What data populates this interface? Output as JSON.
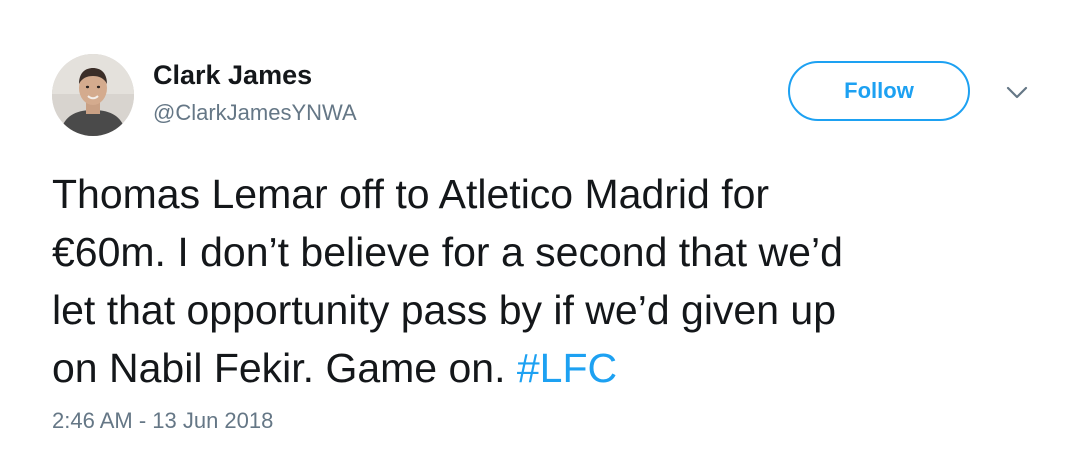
{
  "author": {
    "name": "Clark James",
    "handle": "@ClarkJamesYNWA"
  },
  "follow_button": {
    "label": "Follow"
  },
  "menu": {
    "icon": "chevron-down-icon"
  },
  "tweet": {
    "lines": [
      "Thomas Lemar off to Atletico Madrid for",
      "€60m. I don’t believe for a second that we’d",
      "let that opportunity pass by if we’d given up",
      "on Nabil Fekir. Game on. "
    ],
    "hashtag": "#LFC"
  },
  "timestamp": "2:46 AM - 13 Jun 2018",
  "colors": {
    "accent": "#1da1f2",
    "text": "#14171a",
    "secondary": "#657786"
  }
}
